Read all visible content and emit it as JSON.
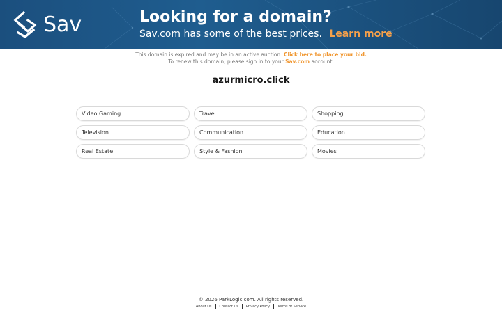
{
  "banner": {
    "logo_text": "Sav",
    "headline": "Looking for a domain?",
    "subline": "Sav.com has some of the best prices.",
    "learn_more": "Learn more",
    "colors": {
      "background": "#1f5d8f",
      "accent": "#f5a04a"
    }
  },
  "notice": {
    "line1_text": "This domain is expired and may be in an active auction.",
    "line1_link": "Click here to place your bid.",
    "line2_before": "To renew this domain, please sign in to your",
    "line2_link": "Sav.com",
    "line2_after": "account."
  },
  "domain_name": "azurmicro.click",
  "categories": [
    "Video Gaming",
    "Travel",
    "Shopping",
    "Television",
    "Communication",
    "Education",
    "Real Estate",
    "Style & Fashion",
    "Movies"
  ],
  "footer": {
    "copyright": "© 2026 ParkLogic.com. All rights reserved.",
    "links": [
      "About Us",
      "Contact Us",
      "Privacy Policy",
      "Terms of Service"
    ]
  }
}
